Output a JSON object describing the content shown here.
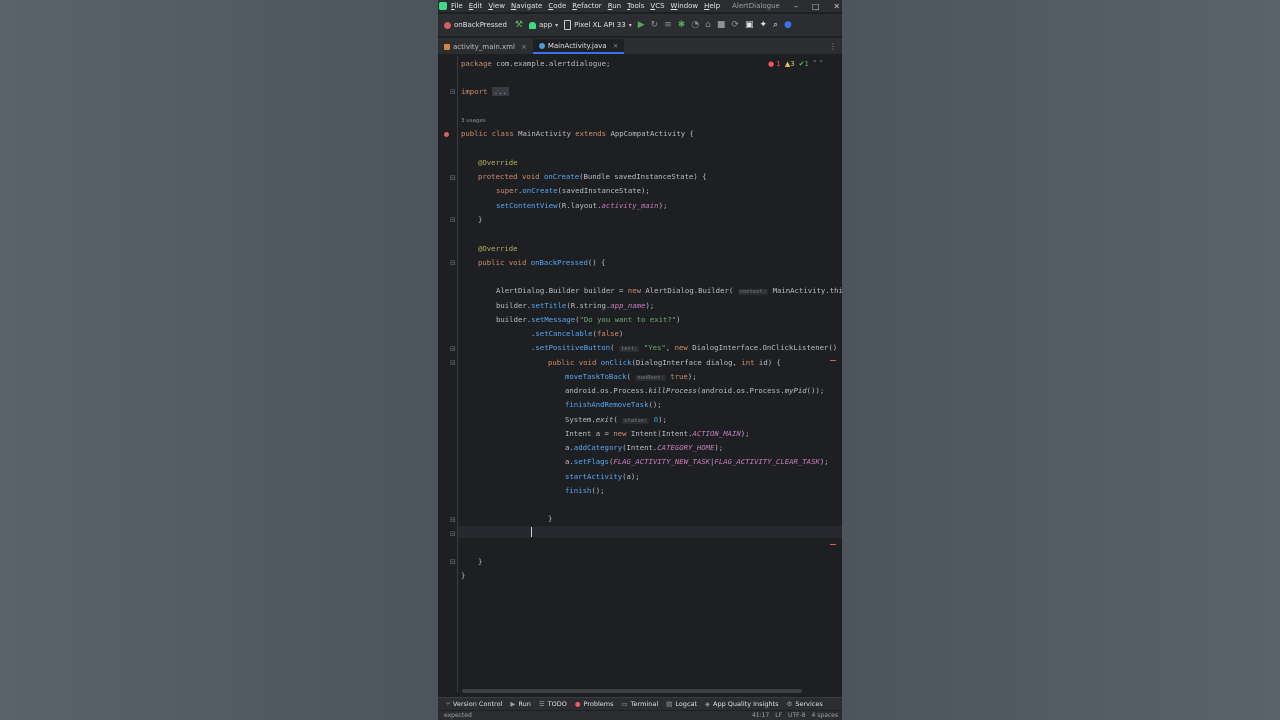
{
  "menu": {
    "items": [
      "File",
      "Edit",
      "View",
      "Navigate",
      "Code",
      "Refactor",
      "Run",
      "Tools",
      "VCS",
      "Window",
      "Help"
    ],
    "project": "AlertDialogue"
  },
  "toolbar": {
    "config": "onBackPressed",
    "module": "app",
    "device": "Pixel XL API 33"
  },
  "tabs": [
    {
      "label": "activity_main.xml",
      "active": false
    },
    {
      "label": "MainActivity.java",
      "active": true
    }
  ],
  "inspections": {
    "errors": "1",
    "warnings": "3",
    "weak": "1"
  },
  "editor": {
    "usages": "3 usages",
    "lines": {
      "pkg_kw": "package",
      "pkg_name": "com.example.alertdialogue",
      "import_kw": "import",
      "import_fold": "...",
      "class_public": "public",
      "class_kw": "class",
      "class_name": "MainActivity",
      "extends_kw": "extends",
      "parent": "AppCompatActivity",
      "override": "@Override",
      "protected": "protected",
      "void": "void",
      "oncreate": "onCreate",
      "bundle": "Bundle savedInstanceState",
      "super": "super",
      "super_call": "(savedInstanceState);",
      "setcontent": "setContentView",
      "r_layout": "R.layout.",
      "activity_main": "activity_main",
      "public": "public",
      "onback": "onBackPressed",
      "builder_type": "AlertDialog.Builder builder = ",
      "new": "new",
      "builder_ctor": "AlertDialog.Builder",
      "hint_context": "context:",
      "main_this": "MainActivity.this",
      "builder": "builder",
      "settitle": "setTitle",
      "r_string": "R.string.",
      "app_name": "app_name",
      "setmessage": "setMessage",
      "msg": "\"Do you want to exit?\"",
      "setcancelable": "setCancelable",
      "false": "false",
      "setpositive": "setPositiveButton",
      "hint_text": "text:",
      "yes": "\"Yes\"",
      "listener": "DialogInterface.OnClickListener() {",
      "onclick": "onClick",
      "onclick_args": "(DialogInterface dialog, ",
      "int": "int",
      "id": " id) {",
      "movetask": "moveTaskToBack",
      "hint_nonroot": "nonRoot:",
      "true": "true",
      "android_process": "android.os.Process.",
      "killprocess": "killProcess",
      "mypid": "myPid",
      "finishremove": "finishAndRemoveTask",
      "system": "System.",
      "exit": "exit",
      "hint_status": "status:",
      "zero": "0",
      "intent_decl": "Intent a = ",
      "intent_new": "Intent(Intent.",
      "action_main": "ACTION_MAIN",
      "addcategory": "addCategory",
      "category_home": "CATEGORY_HOME",
      "setflags": "setFlags",
      "flag_new": "FLAG_ACTIVITY_NEW_TASK",
      "flag_clear": "FLAG_ACTIVITY_CLEAR_TASK",
      "startactivity": "startActivity",
      "finish": "finish"
    }
  },
  "toolwindows": [
    "Version Control",
    "Run",
    "TODO",
    "Problems",
    "Terminal",
    "Logcat",
    "App Quality Insights",
    "Services"
  ],
  "status": {
    "message": "expected",
    "position": "41:17",
    "line_sep": "LF",
    "encoding": "UTF-8",
    "indent": "4 spaces"
  }
}
